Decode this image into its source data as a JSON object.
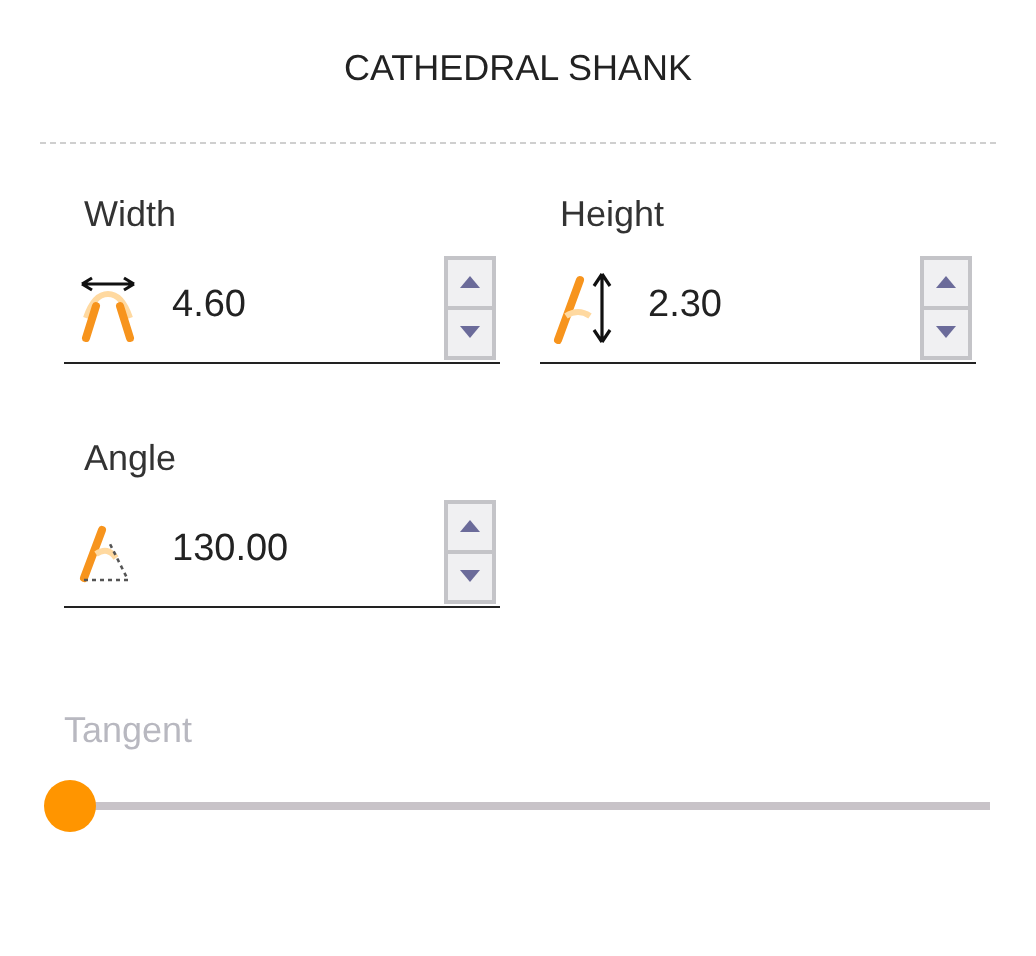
{
  "title": "CATHEDRAL SHANK",
  "fields": [
    {
      "kind": "width",
      "label": "Width",
      "value": "4.60"
    },
    {
      "kind": "height",
      "label": "Height",
      "value": "2.30"
    },
    {
      "kind": "angle",
      "label": "Angle",
      "value": "130.00"
    }
  ],
  "slider": {
    "label": "Tangent",
    "disabled": true,
    "level": 0
  }
}
